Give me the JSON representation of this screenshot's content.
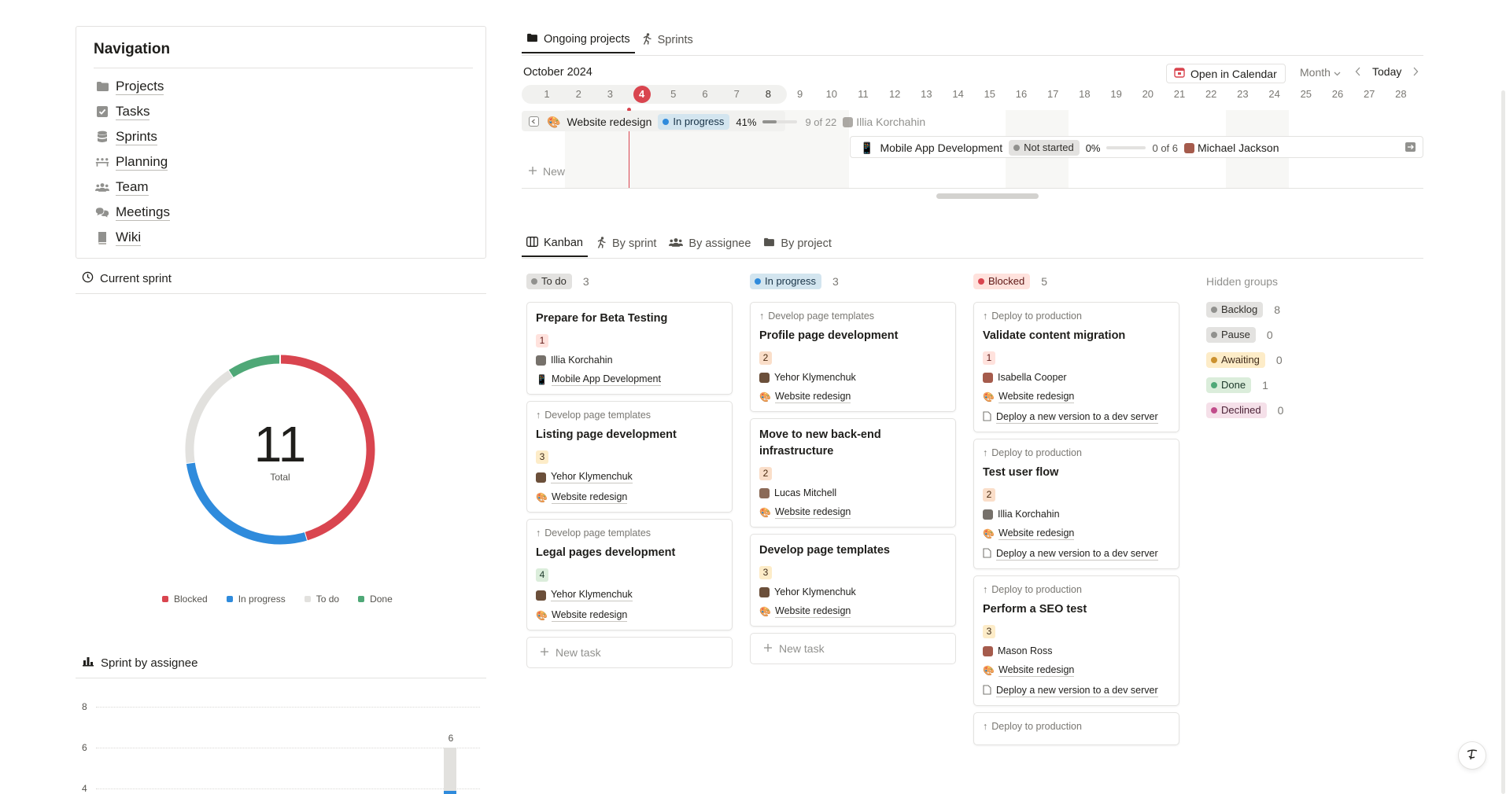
{
  "navigation": {
    "title": "Navigation",
    "items": [
      {
        "label": "Projects",
        "icon": "folder-icon"
      },
      {
        "label": "Tasks",
        "icon": "checkbox-icon"
      },
      {
        "label": "Sprints",
        "icon": "database-icon"
      },
      {
        "label": "Planning",
        "icon": "planning-icon"
      },
      {
        "label": "Team",
        "icon": "team-icon"
      },
      {
        "label": "Meetings",
        "icon": "chat-bubbles-icon"
      },
      {
        "label": "Wiki",
        "icon": "book-icon"
      }
    ]
  },
  "current_sprint": {
    "title": "Current sprint",
    "total_value": "11",
    "total_label": "Total",
    "legend": [
      {
        "label": "Blocked",
        "color": "#d9454f"
      },
      {
        "label": "In progress",
        "color": "#2f8bdc"
      },
      {
        "label": "To do",
        "color": "#e2e1de"
      },
      {
        "label": "Done",
        "color": "#4fa877"
      }
    ]
  },
  "chart_data": {
    "type": "pie",
    "categories": [
      "Blocked",
      "In progress",
      "To do",
      "Done"
    ],
    "values": [
      5,
      3,
      2,
      1
    ],
    "total": 11,
    "colors": [
      "#d9454f",
      "#2f8bdc",
      "#e2e1de",
      "#4fa877"
    ],
    "legend_placement": "bottom"
  },
  "sprint_by_assignee": {
    "title": "Sprint by assignee",
    "yticks": [
      "8",
      "6",
      "4"
    ],
    "bar_label": "6"
  },
  "timeline": {
    "tabs": [
      "Ongoing projects",
      "Sprints"
    ],
    "month_label": "October 2024",
    "open_calendar": "Open in Calendar",
    "view_mode": "Month",
    "today": "Today",
    "days": [
      "1",
      "2",
      "3",
      "4",
      "5",
      "6",
      "7",
      "8",
      "9",
      "10",
      "11",
      "12",
      "13",
      "14",
      "15",
      "16",
      "17",
      "18",
      "19",
      "20",
      "21",
      "22",
      "23",
      "24",
      "25",
      "26",
      "27",
      "28"
    ],
    "today_day": "4",
    "projects": [
      {
        "name": "Website redesign",
        "icon": "🎨",
        "status": "In progress",
        "percent": "41%",
        "progress": 0.41,
        "count": "9 of 22",
        "owner": "Illia Korchahin"
      },
      {
        "name": "Mobile App Development",
        "icon": "📱",
        "status": "Not started",
        "percent": "0%",
        "progress": 0,
        "count": "0 of 6",
        "owner": "Michael Jackson"
      }
    ],
    "new_label": "New"
  },
  "kanban": {
    "tabs": [
      "Kanban",
      "By sprint",
      "By assignee",
      "By project"
    ],
    "new_task": "New task",
    "columns": [
      {
        "name": "To do",
        "count": "3",
        "cards": [
          {
            "title": "Prepare for Beta Testing",
            "num": "1",
            "assignee": "Illia Korchahin",
            "project": "Mobile App Development",
            "project_icon": "📱"
          },
          {
            "parent": "Develop page templates",
            "title": "Listing page development",
            "num": "3",
            "assignee": "Yehor Klymenchuk",
            "project": "Website redesign",
            "project_icon": "🎨"
          },
          {
            "parent": "Develop page templates",
            "title": "Legal pages development",
            "num": "4",
            "assignee": "Yehor Klymenchuk",
            "project": "Website redesign",
            "project_icon": "🎨"
          }
        ]
      },
      {
        "name": "In progress",
        "count": "3",
        "cards": [
          {
            "parent": "Develop page templates",
            "title": "Profile page development",
            "num": "2",
            "assignee": "Yehor Klymenchuk",
            "project": "Website redesign",
            "project_icon": "🎨"
          },
          {
            "title": "Move to new back-end infrastructure",
            "num": "2",
            "assignee": "Lucas Mitchell",
            "project": "Website redesign",
            "project_icon": "🎨"
          },
          {
            "title": "Develop page templates",
            "num": "3",
            "assignee": "Yehor Klymenchuk",
            "project": "Website redesign",
            "project_icon": "🎨"
          }
        ]
      },
      {
        "name": "Blocked",
        "count": "5",
        "cards": [
          {
            "parent": "Deploy to production",
            "title": "Validate content migration",
            "num": "1",
            "assignee": "Isabella Cooper",
            "project": "Website redesign",
            "project_icon": "🎨",
            "blocked_by": "Deploy a new version to a dev server"
          },
          {
            "parent": "Deploy to production",
            "title": "Test user flow",
            "num": "2",
            "assignee": "Illia Korchahin",
            "project": "Website redesign",
            "project_icon": "🎨",
            "blocked_by": "Deploy a new version to a dev server"
          },
          {
            "parent": "Deploy to production",
            "title": "Perform a SEO test",
            "num": "3",
            "assignee": "Mason Ross",
            "project": "Website redesign",
            "project_icon": "🎨",
            "blocked_by": "Deploy a new version to a dev server"
          },
          {
            "parent": "Deploy to production"
          }
        ]
      }
    ],
    "hidden_groups": {
      "title": "Hidden groups",
      "items": [
        {
          "name": "Backlog",
          "count": "8",
          "color": "#91918e"
        },
        {
          "name": "Pause",
          "count": "0",
          "color": "#91918e"
        },
        {
          "name": "Awaiting",
          "count": "0",
          "color": "#cb912f"
        },
        {
          "name": "Done",
          "count": "1",
          "color": "#4fa877"
        },
        {
          "name": "Declined",
          "count": "0",
          "color": "#c14c8a"
        }
      ]
    }
  }
}
